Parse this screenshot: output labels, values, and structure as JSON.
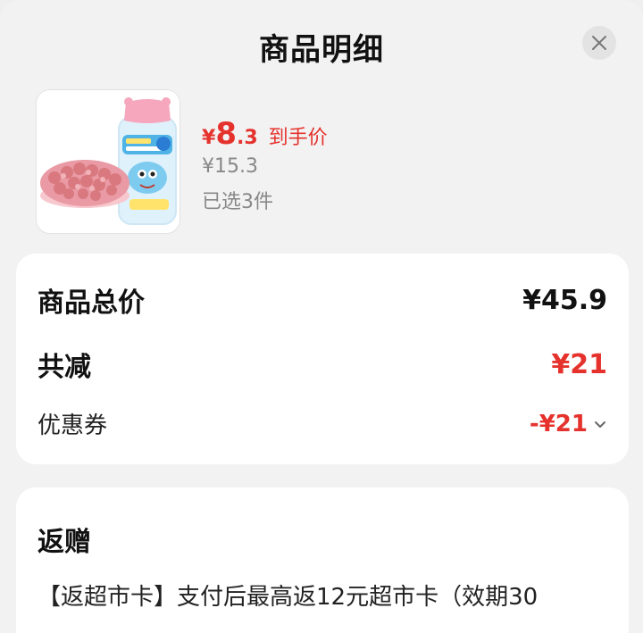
{
  "header": {
    "title": "商品明细",
    "close_icon": "close-icon"
  },
  "product": {
    "image_icon": "product-jar-image",
    "price_symbol": "¥",
    "price_int": "8",
    "price_dec": ".3",
    "price_tag": "到手价",
    "original_price": "¥15.3",
    "selected_qty": "已选3件"
  },
  "summary": {
    "total_label": "商品总价",
    "total_value": "¥45.9",
    "reduce_label": "共减",
    "reduce_value": "¥21",
    "coupon_label": "优惠券",
    "coupon_value": "-¥21",
    "coupon_icon": "chevron-down-icon"
  },
  "gift": {
    "title": "返赠",
    "text": "【返超市卡】支付后最高返12元超市卡（效期30"
  },
  "colors": {
    "accent_red": "#e5322d",
    "background": "#f2f2f2",
    "card": "#ffffff"
  }
}
